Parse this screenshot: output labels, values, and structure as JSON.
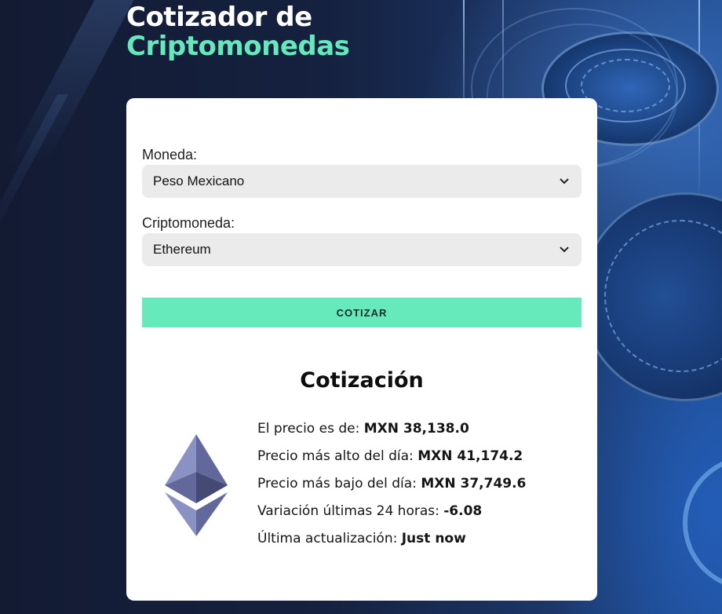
{
  "header": {
    "title_line1": "Cotizador de",
    "title_line2": "Criptomonedas"
  },
  "form": {
    "currency_label": "Moneda:",
    "currency_value": "Peso Mexicano",
    "crypto_label": "Criptomoneda:",
    "crypto_value": "Ethereum",
    "submit_label": "COTIZAR"
  },
  "result": {
    "title": "Cotización",
    "coin_icon": "ethereum-icon",
    "rows": [
      {
        "label": "El precio es de: ",
        "value": "MXN 38,138.0"
      },
      {
        "label": "Precio más alto del día: ",
        "value": "MXN 41,174.2"
      },
      {
        "label": "Precio más bajo del día: ",
        "value": "MXN 37,749.6"
      },
      {
        "label": "Variación últimas 24 horas: ",
        "value": "-6.08"
      },
      {
        "label": "Última actualización: ",
        "value": "Just now"
      }
    ]
  },
  "colors": {
    "accent": "#66eabb",
    "background": "#15213f",
    "card": "#ffffff"
  }
}
